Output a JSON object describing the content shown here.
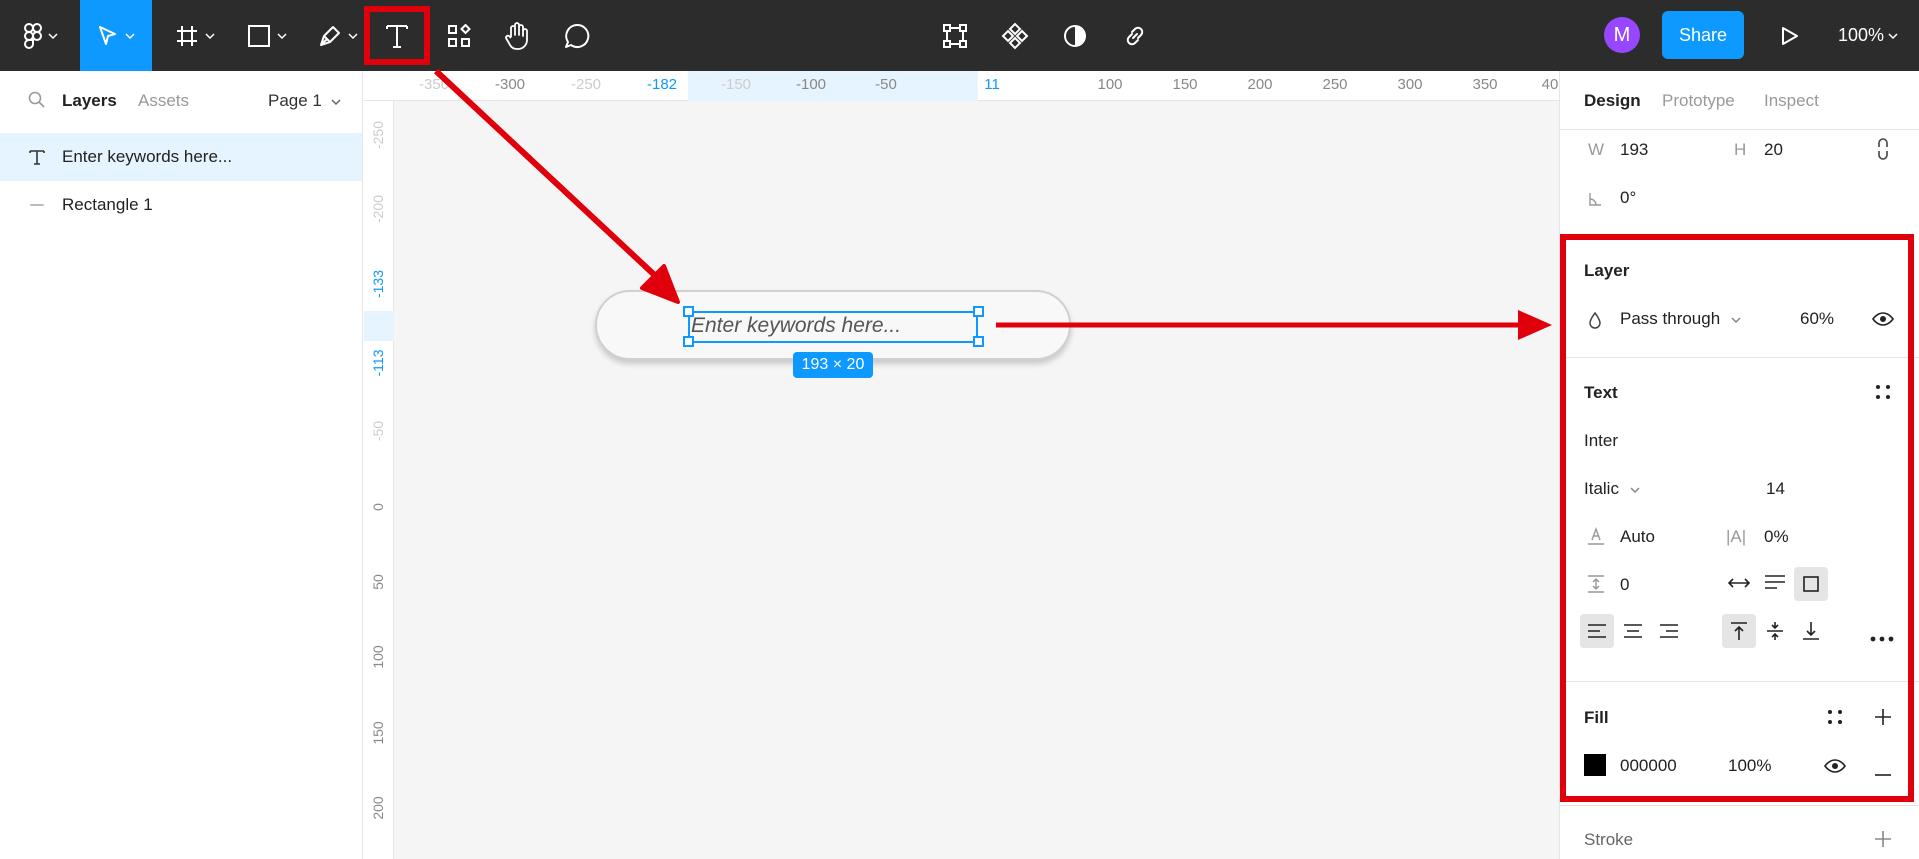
{
  "toolbar": {
    "zoom": "100%",
    "share_label": "Share",
    "avatar_initial": "M",
    "accent": "#0d99ff"
  },
  "left_panel": {
    "tabs": {
      "layers": "Layers",
      "assets": "Assets",
      "page": "Page 1"
    },
    "layers": [
      {
        "name": "Enter keywords here...",
        "icon": "text-icon",
        "selected": true
      },
      {
        "name": "Rectangle 1",
        "icon": "rectangle-layer-icon",
        "selected": false
      }
    ]
  },
  "canvas": {
    "ruler_top": [
      "-350",
      "-300",
      "-250",
      "-182",
      "-150",
      "-100",
      "-50",
      "11",
      "100",
      "150",
      "200",
      "250",
      "300",
      "350",
      "40"
    ],
    "ruler_left": [
      "-250",
      "-200",
      "-133",
      "-113",
      "-50",
      "0",
      "50",
      "100",
      "150",
      "200"
    ],
    "text_layer": "Enter keywords here...",
    "dimensions": "193 × 20"
  },
  "right_panel": {
    "tabs": {
      "design": "Design",
      "prototype": "Prototype",
      "inspect": "Inspect"
    },
    "size": {
      "w_label": "W",
      "w": "193",
      "h_label": "H",
      "h": "20",
      "rotation": "0°"
    },
    "layer": {
      "title": "Layer",
      "blend": "Pass through",
      "opacity": "60%"
    },
    "text": {
      "title": "Text",
      "font": "Inter",
      "style": "Italic",
      "size": "14",
      "line_height": "Auto",
      "letter_spacing_icon": "|A|",
      "letter_spacing": "0%",
      "paragraph_spacing": "0"
    },
    "fill": {
      "title": "Fill",
      "hex": "000000",
      "opacity": "100%",
      "swatch": "#000000"
    },
    "stroke": {
      "title": "Stroke"
    }
  },
  "annotation_color": "#e0000b"
}
